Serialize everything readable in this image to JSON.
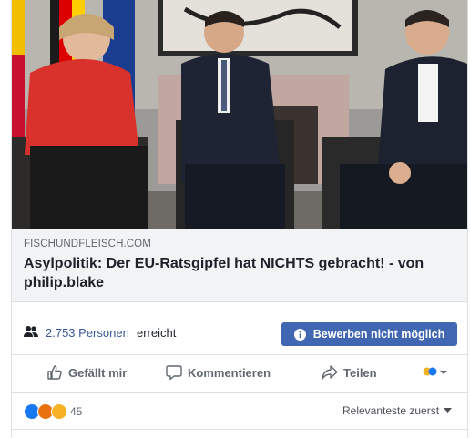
{
  "post": {
    "link_domain": "FISCHUNDFLEISCH.COM",
    "link_title": "Asylpolitik: Der EU-Ratsgipfel hat NICHTS gebracht! - von philip.blake"
  },
  "insights": {
    "reach_count": "2.753 Personen",
    "reach_label": "erreicht",
    "boost_label": "Bewerben nicht möglich"
  },
  "actions": {
    "like": "Gefällt mir",
    "comment": "Kommentieren",
    "share": "Teilen"
  },
  "reactions": {
    "count": "45",
    "sort_label": "Relevanteste zuerst",
    "types": [
      "like",
      "angry",
      "haha"
    ]
  },
  "colors": {
    "link_blue": "#385898",
    "button_blue": "#4267b2",
    "like_blue": "#1877f2",
    "angry_red": "#e9710f",
    "haha_yellow": "#f7b125"
  }
}
